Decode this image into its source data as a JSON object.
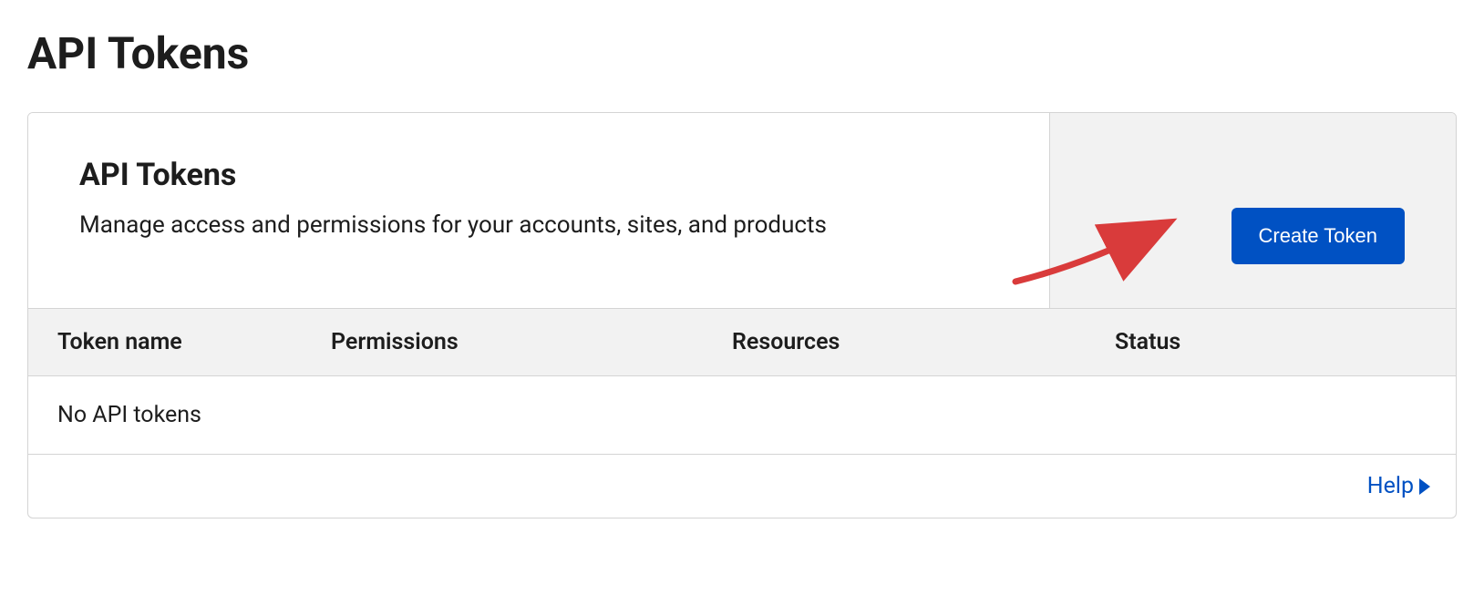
{
  "page": {
    "title": "API Tokens"
  },
  "panel": {
    "title": "API Tokens",
    "description": "Manage access and permissions for your accounts, sites, and products",
    "create_button_label": "Create Token"
  },
  "table": {
    "columns": {
      "token_name": "Token name",
      "permissions": "Permissions",
      "resources": "Resources",
      "status": "Status"
    },
    "empty_message": "No API tokens"
  },
  "footer": {
    "help_label": "Help"
  }
}
